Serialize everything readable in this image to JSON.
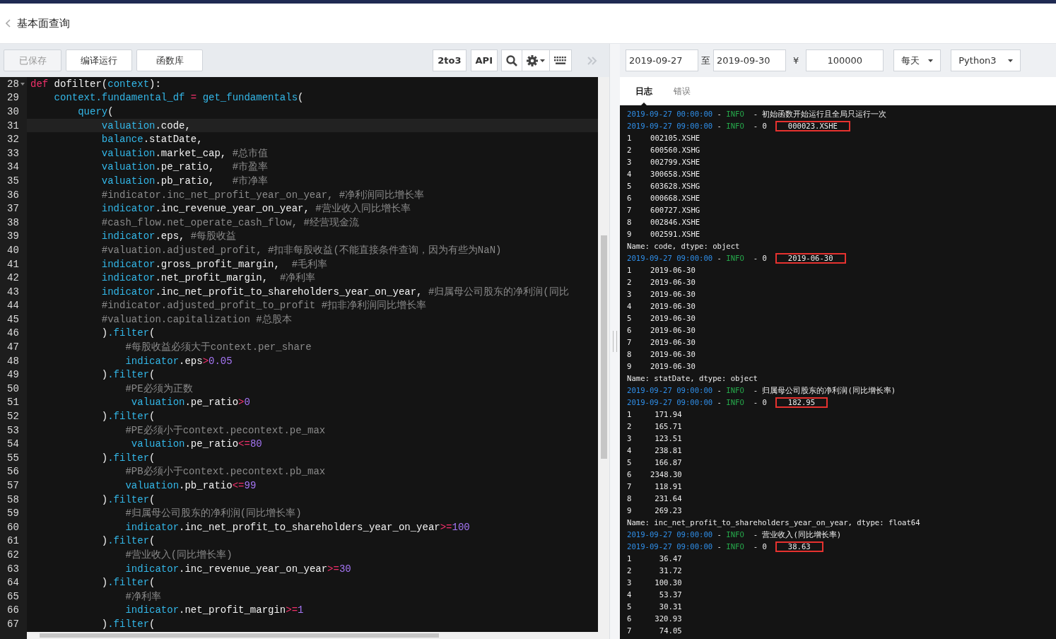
{
  "header": {
    "title": "基本面查询"
  },
  "toolbar": {
    "buttons": [
      {
        "label": "已保存",
        "disabled": true
      },
      {
        "label": "编译运行",
        "disabled": false
      },
      {
        "label": "函数库",
        "disabled": false
      }
    ],
    "tools": [
      "2to3",
      "API"
    ]
  },
  "backtest": {
    "start_date": "2019-09-27",
    "to": "至",
    "end_date": "2019-09-30",
    "currency": "¥",
    "capital": "100000",
    "frequency": "每天",
    "language": "Python3"
  },
  "editor": {
    "lines": [
      {
        "num": "28",
        "fold": true,
        "tokens": [
          {
            "kind": "kw",
            "text": "def"
          },
          {
            "kind": "tx",
            "text": " dofilter("
          },
          {
            "kind": "id",
            "text": "context"
          },
          {
            "kind": "tx",
            "text": "):"
          }
        ]
      },
      {
        "num": "29",
        "tokens": [
          {
            "kind": "id",
            "text": "    context.fundamental_df"
          },
          {
            "kind": "op",
            "text": " = "
          },
          {
            "kind": "id",
            "text": "get_fundamentals"
          },
          {
            "kind": "tx",
            "text": "("
          }
        ]
      },
      {
        "num": "30",
        "tokens": [
          {
            "kind": "id",
            "text": "        query"
          },
          {
            "kind": "tx",
            "text": "("
          }
        ]
      },
      {
        "num": "31",
        "current": true,
        "tokens": [
          {
            "kind": "id",
            "text": "            valuation"
          },
          {
            "kind": "tx",
            "text": ".code,"
          }
        ]
      },
      {
        "num": "32",
        "tokens": [
          {
            "kind": "id",
            "text": "            balance"
          },
          {
            "kind": "tx",
            "text": ".statDate,"
          }
        ]
      },
      {
        "num": "33",
        "tokens": [
          {
            "kind": "id",
            "text": "            valuation"
          },
          {
            "kind": "tx",
            "text": ".market_cap, "
          },
          {
            "kind": "cm",
            "text": "#总市值"
          }
        ]
      },
      {
        "num": "34",
        "tokens": [
          {
            "kind": "id",
            "text": "            valuation"
          },
          {
            "kind": "tx",
            "text": ".pe_ratio,   "
          },
          {
            "kind": "cm",
            "text": "#市盈率"
          }
        ]
      },
      {
        "num": "35",
        "tokens": [
          {
            "kind": "id",
            "text": "            valuation"
          },
          {
            "kind": "tx",
            "text": ".pb_ratio,   "
          },
          {
            "kind": "cm",
            "text": "#市净率"
          }
        ]
      },
      {
        "num": "36",
        "tokens": [
          {
            "kind": "cm",
            "text": "            #indicator.inc_net_profit_year_on_year, #净利润同比增长率"
          }
        ]
      },
      {
        "num": "37",
        "tokens": [
          {
            "kind": "id",
            "text": "            indicator"
          },
          {
            "kind": "tx",
            "text": ".inc_revenue_year_on_year, "
          },
          {
            "kind": "cm",
            "text": "#营业收入同比增长率"
          }
        ]
      },
      {
        "num": "38",
        "tokens": [
          {
            "kind": "cm",
            "text": "            #cash_flow.net_operate_cash_flow, #经营现金流"
          }
        ]
      },
      {
        "num": "39",
        "tokens": [
          {
            "kind": "id",
            "text": "            indicator"
          },
          {
            "kind": "tx",
            "text": ".eps, "
          },
          {
            "kind": "cm",
            "text": "#每股收益"
          }
        ]
      },
      {
        "num": "40",
        "tokens": [
          {
            "kind": "cm",
            "text": "            #valuation.adjusted_profit, #扣非每股收益(不能直接条件查询，因为有些为NaN)"
          }
        ]
      },
      {
        "num": "41",
        "tokens": [
          {
            "kind": "id",
            "text": "            indicator"
          },
          {
            "kind": "tx",
            "text": ".gross_profit_margin,  "
          },
          {
            "kind": "cm",
            "text": "#毛利率"
          }
        ]
      },
      {
        "num": "42",
        "tokens": [
          {
            "kind": "id",
            "text": "            indicator"
          },
          {
            "kind": "tx",
            "text": ".net_profit_margin,  "
          },
          {
            "kind": "cm",
            "text": "#净利率"
          }
        ]
      },
      {
        "num": "43",
        "tokens": [
          {
            "kind": "id",
            "text": "            indicator"
          },
          {
            "kind": "tx",
            "text": ".inc_net_profit_to_shareholders_year_on_year, "
          },
          {
            "kind": "cm",
            "text": "#归属母公司股东的净利润(同比"
          }
        ]
      },
      {
        "num": "44",
        "tokens": [
          {
            "kind": "cm",
            "text": "            #indicator.adjusted_profit_to_profit #扣非净利润同比增长率"
          }
        ]
      },
      {
        "num": "45",
        "tokens": [
          {
            "kind": "cm",
            "text": "            #valuation.capitalization #总股本"
          }
        ]
      },
      {
        "num": "46",
        "tokens": [
          {
            "kind": "tx",
            "text": "            )"
          },
          {
            "kind": "id",
            "text": ".filter"
          },
          {
            "kind": "tx",
            "text": "("
          }
        ]
      },
      {
        "num": "47",
        "tokens": [
          {
            "kind": "cm",
            "text": "                #每股收益必须大于context.per_share"
          }
        ]
      },
      {
        "num": "48",
        "tokens": [
          {
            "kind": "id",
            "text": "                indicator"
          },
          {
            "kind": "tx",
            "text": ".eps"
          },
          {
            "kind": "op",
            "text": ">"
          },
          {
            "kind": "num",
            "text": "0.05"
          }
        ]
      },
      {
        "num": "49",
        "tokens": [
          {
            "kind": "tx",
            "text": "            )"
          },
          {
            "kind": "id",
            "text": ".filter"
          },
          {
            "kind": "tx",
            "text": "("
          }
        ]
      },
      {
        "num": "50",
        "tokens": [
          {
            "kind": "cm",
            "text": "                #PE必须为正数"
          }
        ]
      },
      {
        "num": "51",
        "tokens": [
          {
            "kind": "id",
            "text": "                 valuation"
          },
          {
            "kind": "tx",
            "text": ".pe_ratio"
          },
          {
            "kind": "op",
            "text": ">"
          },
          {
            "kind": "num",
            "text": "0"
          }
        ]
      },
      {
        "num": "52",
        "tokens": [
          {
            "kind": "tx",
            "text": "            )"
          },
          {
            "kind": "id",
            "text": ".filter"
          },
          {
            "kind": "tx",
            "text": "("
          }
        ]
      },
      {
        "num": "53",
        "tokens": [
          {
            "kind": "cm",
            "text": "                #PE必须小于context.pecontext.pe_max"
          }
        ]
      },
      {
        "num": "54",
        "tokens": [
          {
            "kind": "id",
            "text": "                 valuation"
          },
          {
            "kind": "tx",
            "text": ".pe_ratio"
          },
          {
            "kind": "op",
            "text": "<="
          },
          {
            "kind": "num",
            "text": "80"
          }
        ]
      },
      {
        "num": "55",
        "tokens": [
          {
            "kind": "tx",
            "text": "            )"
          },
          {
            "kind": "id",
            "text": ".filter"
          },
          {
            "kind": "tx",
            "text": "("
          }
        ]
      },
      {
        "num": "56",
        "tokens": [
          {
            "kind": "cm",
            "text": "                #PB必须小于context.pecontext.pb_max"
          }
        ]
      },
      {
        "num": "57",
        "tokens": [
          {
            "kind": "id",
            "text": "                valuation"
          },
          {
            "kind": "tx",
            "text": ".pb_ratio"
          },
          {
            "kind": "op",
            "text": "<="
          },
          {
            "kind": "num",
            "text": "99"
          }
        ]
      },
      {
        "num": "58",
        "tokens": [
          {
            "kind": "tx",
            "text": "            )"
          },
          {
            "kind": "id",
            "text": ".filter"
          },
          {
            "kind": "tx",
            "text": "("
          }
        ]
      },
      {
        "num": "59",
        "tokens": [
          {
            "kind": "cm",
            "text": "                #归属母公司股东的净利润(同比增长率)"
          }
        ]
      },
      {
        "num": "60",
        "tokens": [
          {
            "kind": "id",
            "text": "                indicator"
          },
          {
            "kind": "tx",
            "text": ".inc_net_profit_to_shareholders_year_on_year"
          },
          {
            "kind": "op",
            "text": ">="
          },
          {
            "kind": "num",
            "text": "100"
          }
        ]
      },
      {
        "num": "61",
        "tokens": [
          {
            "kind": "tx",
            "text": "            )"
          },
          {
            "kind": "id",
            "text": ".filter"
          },
          {
            "kind": "tx",
            "text": "("
          }
        ]
      },
      {
        "num": "62",
        "tokens": [
          {
            "kind": "cm",
            "text": "                #营业收入(同比增长率)"
          }
        ]
      },
      {
        "num": "63",
        "tokens": [
          {
            "kind": "id",
            "text": "                indicator"
          },
          {
            "kind": "tx",
            "text": ".inc_revenue_year_on_year"
          },
          {
            "kind": "op",
            "text": ">="
          },
          {
            "kind": "num",
            "text": "30"
          }
        ]
      },
      {
        "num": "64",
        "tokens": [
          {
            "kind": "tx",
            "text": "            )"
          },
          {
            "kind": "id",
            "text": ".filter"
          },
          {
            "kind": "tx",
            "text": "("
          }
        ]
      },
      {
        "num": "65",
        "tokens": [
          {
            "kind": "cm",
            "text": "                #净利率"
          }
        ]
      },
      {
        "num": "66",
        "tokens": [
          {
            "kind": "id",
            "text": "                indicator"
          },
          {
            "kind": "tx",
            "text": ".net_profit_margin"
          },
          {
            "kind": "op",
            "text": ">="
          },
          {
            "kind": "num",
            "text": "1"
          }
        ]
      },
      {
        "num": "67",
        "tokens": [
          {
            "kind": "tx",
            "text": "            )"
          },
          {
            "kind": "id",
            "text": ".filter"
          },
          {
            "kind": "tx",
            "text": "("
          }
        ]
      }
    ]
  },
  "log_tabs": [
    {
      "label": "日志",
      "selected": true
    },
    {
      "label": "错误",
      "selected": false
    }
  ],
  "log": [
    {
      "kind": "log",
      "time": "2019-09-27 00:00:00",
      "dash": "-",
      "level": "INFO",
      "message": "- 初始函数开始运行且全局只运行一次"
    },
    {
      "kind": "log",
      "time": "2019-09-27 09:00:00",
      "dash": "-",
      "level": "INFO",
      "message": "- 0",
      "value": "000023.XSHE",
      "boxed": true
    },
    {
      "kind": "row",
      "index": "1",
      "value": "002105.XSHE"
    },
    {
      "kind": "row",
      "index": "2",
      "value": "600560.XSHG"
    },
    {
      "kind": "row",
      "index": "3",
      "value": "002799.XSHE"
    },
    {
      "kind": "row",
      "index": "4",
      "value": "300658.XSHE"
    },
    {
      "kind": "row",
      "index": "5",
      "value": "603628.XSHG"
    },
    {
      "kind": "row",
      "index": "6",
      "value": "000668.XSHE"
    },
    {
      "kind": "row",
      "index": "7",
      "value": "600727.XSHG"
    },
    {
      "kind": "row",
      "index": "8",
      "value": "002846.XSHE"
    },
    {
      "kind": "row",
      "index": "9",
      "value": "002591.XSHE"
    },
    {
      "kind": "name",
      "text": "Name: code, dtype: object"
    },
    {
      "kind": "log",
      "time": "2019-09-27 09:00:00",
      "dash": "-",
      "level": "INFO",
      "message": "- 0",
      "value": "2019-06-30",
      "boxed": true
    },
    {
      "kind": "row",
      "index": "1",
      "value": "2019-06-30"
    },
    {
      "kind": "row",
      "index": "2",
      "value": "2019-06-30"
    },
    {
      "kind": "row",
      "index": "3",
      "value": "2019-06-30"
    },
    {
      "kind": "row",
      "index": "4",
      "value": "2019-06-30"
    },
    {
      "kind": "row",
      "index": "5",
      "value": "2019-06-30"
    },
    {
      "kind": "row",
      "index": "6",
      "value": "2019-06-30"
    },
    {
      "kind": "row",
      "index": "7",
      "value": "2019-06-30"
    },
    {
      "kind": "row",
      "index": "8",
      "value": "2019-06-30"
    },
    {
      "kind": "row",
      "index": "9",
      "value": "2019-06-30"
    },
    {
      "kind": "name",
      "text": "Name: statDate, dtype: object"
    },
    {
      "kind": "log",
      "time": "2019-09-27 09:00:00",
      "dash": "-",
      "level": "INFO",
      "message": "- 归属母公司股东的净利润(同比增长率)"
    },
    {
      "kind": "log",
      "time": "2019-09-27 09:00:00",
      "dash": "-",
      "level": "INFO",
      "message": "- 0",
      "value": "182.95",
      "boxed": true
    },
    {
      "kind": "row",
      "index": "1",
      "value": "171.94"
    },
    {
      "kind": "row",
      "index": "2",
      "value": "165.71"
    },
    {
      "kind": "row",
      "index": "3",
      "value": "123.51"
    },
    {
      "kind": "row",
      "index": "4",
      "value": "238.81"
    },
    {
      "kind": "row",
      "index": "5",
      "value": "166.87"
    },
    {
      "kind": "row",
      "index": "6",
      "value": "2348.30"
    },
    {
      "kind": "row",
      "index": "7",
      "value": "118.91"
    },
    {
      "kind": "row",
      "index": "8",
      "value": "231.64"
    },
    {
      "kind": "row",
      "index": "9",
      "value": "269.23"
    },
    {
      "kind": "name",
      "text": "Name: inc_net_profit_to_shareholders_year_on_year, dtype: float64"
    },
    {
      "kind": "log",
      "time": "2019-09-27 09:00:00",
      "dash": "-",
      "level": "INFO",
      "message": "- 营业收入(同比增长率)"
    },
    {
      "kind": "log",
      "time": "2019-09-27 09:00:00",
      "dash": "-",
      "level": "INFO",
      "message": "- 0",
      "value": "38.63",
      "boxed": true
    },
    {
      "kind": "row",
      "index": "1",
      "value": "36.47"
    },
    {
      "kind": "row",
      "index": "2",
      "value": "31.72"
    },
    {
      "kind": "row",
      "index": "3",
      "value": "100.30"
    },
    {
      "kind": "row",
      "index": "4",
      "value": "53.37"
    },
    {
      "kind": "row",
      "index": "5",
      "value": "30.31"
    },
    {
      "kind": "row",
      "index": "6",
      "value": "320.93"
    },
    {
      "kind": "row",
      "index": "7",
      "value": "74.05"
    }
  ]
}
